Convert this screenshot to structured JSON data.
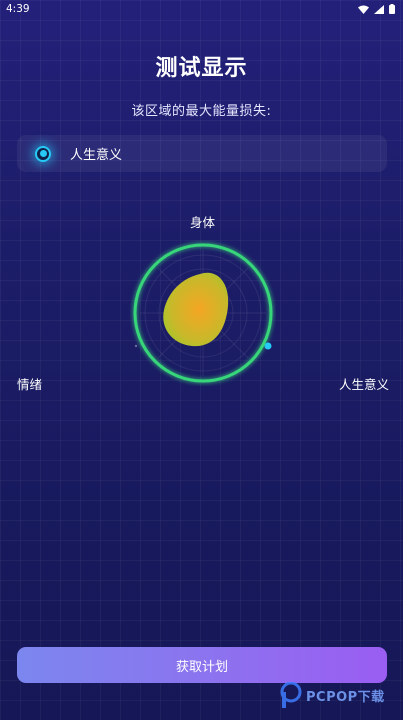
{
  "status_bar": {
    "time": "4:39"
  },
  "page": {
    "title": "测试显示",
    "subtitle": "该区域的最大能量损失:"
  },
  "option": {
    "label": "人生意义",
    "selected": true
  },
  "radar": {
    "top_label": "身体",
    "left_label": "情绪",
    "right_label": "人生意义"
  },
  "button": {
    "label": "获取计划"
  },
  "watermark": {
    "text": "PCPOP下载"
  },
  "colors": {
    "accent": "#27c9f5",
    "ring": "#37d67a",
    "blob_center": "#f5a623",
    "blob_edge": "#a6c62c",
    "button_start": "#7c86ef",
    "button_end": "#9a5df2"
  },
  "icons": [
    "wifi-icon",
    "signal-icon",
    "battery-icon",
    "radio-selected-icon"
  ]
}
